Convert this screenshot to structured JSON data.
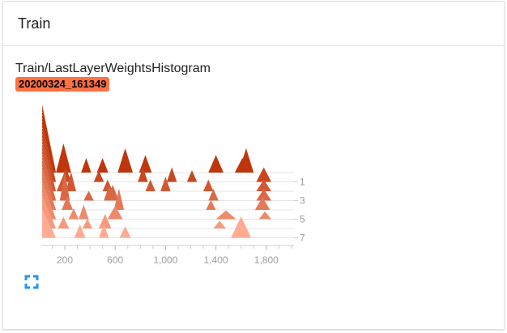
{
  "card": {
    "title": "Train"
  },
  "plot": {
    "title": "Train/LastLayerWeightsHistogram",
    "run": "20200324_161349",
    "run_color": "#ff7043"
  },
  "icons": {
    "fullscreen": "fullscreen-icon"
  },
  "chart_data": {
    "type": "area",
    "xlim": [
      20,
      2020
    ],
    "x_ticks": [
      200,
      600,
      1000,
      1400,
      1800
    ],
    "x_tick_labels": [
      "200",
      "600",
      "1,000",
      "1,400",
      "1,800"
    ],
    "step_labels": [
      "1",
      "3",
      "5",
      "7"
    ],
    "colors": {
      "first": "#bf360c",
      "last": "#ffab91"
    },
    "series": [
      {
        "step": 0,
        "peaks": [
          [
            20,
            70,
            110
          ],
          [
            190,
            30,
            60
          ],
          [
            370,
            15,
            40
          ],
          [
            500,
            15,
            45
          ],
          [
            680,
            25,
            60
          ],
          [
            840,
            18,
            50
          ],
          [
            1400,
            18,
            60
          ],
          [
            1610,
            15,
            60
          ],
          [
            1640,
            25,
            60
          ]
        ]
      },
      {
        "step": 1,
        "peaks": [
          [
            20,
            60,
            110
          ],
          [
            210,
            15,
            40
          ],
          [
            470,
            12,
            40
          ],
          [
            820,
            15,
            40
          ],
          [
            1050,
            15,
            40
          ],
          [
            1210,
            12,
            40
          ],
          [
            1780,
            15,
            60
          ]
        ]
      },
      {
        "step": 2,
        "peaks": [
          [
            20,
            55,
            110
          ],
          [
            180,
            14,
            45
          ],
          [
            250,
            20,
            40
          ],
          [
            540,
            12,
            40
          ],
          [
            880,
            12,
            40
          ],
          [
            1000,
            15,
            40
          ],
          [
            1340,
            12,
            40
          ],
          [
            1780,
            12,
            60
          ]
        ]
      },
      {
        "step": 3,
        "peaks": [
          [
            20,
            50,
            110
          ],
          [
            200,
            30,
            40
          ],
          [
            390,
            10,
            40
          ],
          [
            550,
            15,
            40
          ],
          [
            580,
            16,
            50
          ],
          [
            1380,
            12,
            40
          ],
          [
            1780,
            12,
            60
          ]
        ]
      },
      {
        "step": 4,
        "peaks": [
          [
            20,
            45,
            110
          ],
          [
            220,
            14,
            45
          ],
          [
            630,
            22,
            40
          ],
          [
            1360,
            10,
            40
          ],
          [
            1770,
            13,
            60
          ]
        ]
      },
      {
        "step": 5,
        "peaks": [
          [
            20,
            40,
            110
          ],
          [
            270,
            11,
            40
          ],
          [
            350,
            15,
            40
          ],
          [
            600,
            14,
            60
          ],
          [
            1480,
            9,
            80
          ],
          [
            1790,
            8,
            50
          ]
        ]
      },
      {
        "step": 6,
        "peaks": [
          [
            20,
            35,
            110
          ],
          [
            190,
            12,
            45
          ],
          [
            380,
            10,
            40
          ],
          [
            520,
            15,
            50
          ],
          [
            1430,
            8,
            50
          ]
        ]
      },
      {
        "step": 7,
        "peaks": [
          [
            20,
            30,
            110
          ],
          [
            320,
            14,
            45
          ],
          [
            510,
            14,
            40
          ],
          [
            680,
            12,
            45
          ],
          [
            1600,
            22,
            80
          ]
        ]
      }
    ]
  }
}
